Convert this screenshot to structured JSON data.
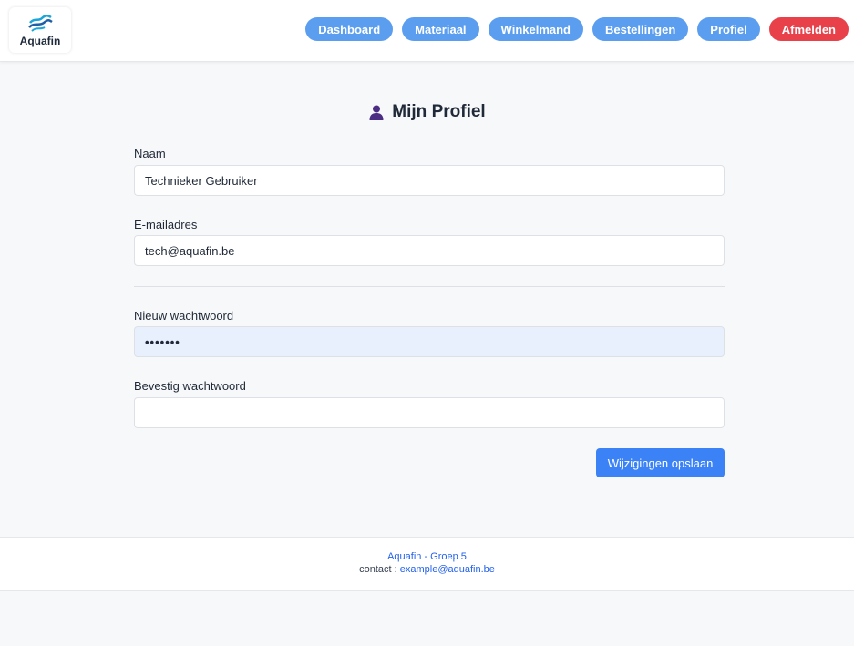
{
  "brand": {
    "name": "Aquafin",
    "icon": "aquafin-wave-logo"
  },
  "nav": {
    "items": [
      {
        "label": "Dashboard"
      },
      {
        "label": "Materiaal"
      },
      {
        "label": "Winkelmand"
      },
      {
        "label": "Bestellingen"
      },
      {
        "label": "Profiel"
      },
      {
        "label": "Afmelden"
      }
    ],
    "accent": "#5b9ef0",
    "logout_color": "#e8414a"
  },
  "page": {
    "icon": "user-icon",
    "title": "Mijn Profiel"
  },
  "form": {
    "name_label": "Naam",
    "name_value": "Technieker Gebruiker",
    "email_label": "E-mailadres",
    "email_value": "tech@aquafin.be",
    "new_password_label": "Nieuw wachtwoord",
    "new_password_value": "•••••••",
    "confirm_password_label": "Bevestig wachtwoord",
    "confirm_password_value": "",
    "save_label": "Wijzigingen opslaan",
    "save_color": "#3b82f6"
  },
  "footer": {
    "title": "Aquafin - Groep 5",
    "contact_prefix": "contact :",
    "contact_email": "example@aquafin.be"
  }
}
